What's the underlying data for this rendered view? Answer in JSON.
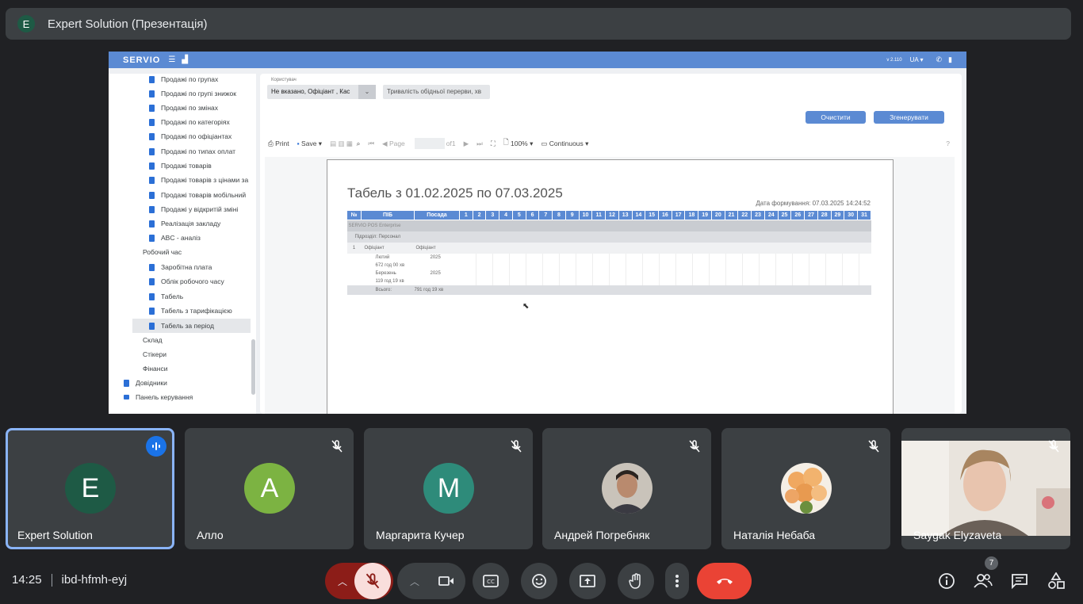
{
  "presenter": {
    "avatar": "E",
    "title": "Expert Solution (Презентація)"
  },
  "app": {
    "logo": "SERVIO",
    "version": "v 2.110",
    "lang": "UA",
    "sidebar": [
      "Продажі по групах",
      "Продажі по групі знижок",
      "Продажі по змінах",
      "Продажі по категоріях",
      "Продажі по офіціантах",
      "Продажі по типах оплат",
      "Продажі товарів",
      "Продажі товарів з цінами за",
      "Продажі товарів мобільний",
      "Продажі у відкритій зміні",
      "Реалізація закладу",
      "ABC - аналіз",
      "Робочий час",
      "Заробітна плата",
      "Облік робочого часу",
      "Табель",
      "Табель з тарифікацією",
      "Табель за період",
      "Склад",
      "Стікери",
      "Фінанси",
      "Довідники",
      "Панель керування"
    ],
    "user_label": "Користувач",
    "user_value": "Не вказано, Офіціант , Кас",
    "break_placeholder": "Тривалість обідньої перерви, хв",
    "clear_btn": "Очистити",
    "generate_btn": "Згенерувати",
    "toolbar": {
      "print": "Print",
      "save": "Save",
      "page": "Page",
      "of": "of1",
      "zoom": "100%",
      "mode": "Continuous",
      "help": "?"
    },
    "report": {
      "title": "Табель з 01.02.2025 по 07.03.2025",
      "date": "Дата формування: 07.03.2025 14:24:52",
      "headers": [
        "№",
        "ПІБ",
        "Посада",
        "1",
        "2",
        "3",
        "4",
        "5",
        "6",
        "7",
        "8",
        "9",
        "10",
        "11",
        "12",
        "13",
        "14",
        "15",
        "16",
        "17",
        "18",
        "19",
        "20",
        "21",
        "22",
        "23",
        "24",
        "25",
        "26",
        "27",
        "28",
        "29",
        "30",
        "31"
      ],
      "company": "SERVIO POS Enterprise",
      "dept": "Підрозділ: Персонал",
      "pos_num": "1",
      "pos_name": "Офіціант",
      "pos_role": "Офіціант",
      "rows": [
        {
          "name": "Лютий",
          "year": "2025",
          "hours": "672 год 00 хв"
        },
        {
          "name": "Березень",
          "year": "2025",
          "hours": "119 год 19 хв"
        }
      ],
      "total_label": "Всього:",
      "total_value": "791 год 19 хв"
    }
  },
  "participants": [
    {
      "name": "Expert Solution",
      "initial": "E",
      "color": "#1e5a45"
    },
    {
      "name": "Алло",
      "initial": "A",
      "color": "#7cb342"
    },
    {
      "name": "Маргарита Кучер",
      "initial": "M",
      "color": "#2e8b7a"
    },
    {
      "name": "Андрей Погребняк"
    },
    {
      "name": "Наталія Небаба"
    },
    {
      "name": "Saygak Elyzaveta"
    }
  ],
  "meeting": {
    "time": "14:25",
    "code": "ibd-hfmh-eyj",
    "participant_count": "7"
  }
}
